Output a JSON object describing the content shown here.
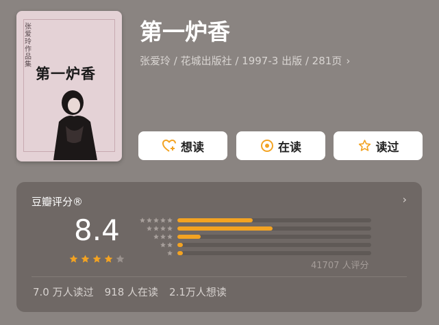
{
  "book": {
    "title": "第一炉香",
    "meta": "张爱玲 / 花城出版社 / 1997-3 出版 / 281页",
    "cover": {
      "author_series": "张爱玲作品集",
      "title": "第一炉香"
    }
  },
  "actions": [
    {
      "label": "想读",
      "icon": "heart-plus-icon"
    },
    {
      "label": "在读",
      "icon": "target-circle-icon"
    },
    {
      "label": "读过",
      "icon": "star-outline-icon"
    }
  ],
  "rating": {
    "label": "豆瓣评分®",
    "score": "8.4",
    "stars": 4,
    "distribution": [
      {
        "stars": 5,
        "fraction": 0.39
      },
      {
        "stars": 4,
        "fraction": 0.49
      },
      {
        "stars": 3,
        "fraction": 0.12
      },
      {
        "stars": 2,
        "fraction": 0.03
      },
      {
        "stars": 1,
        "fraction": 0.02
      }
    ],
    "raters": "41707 人评分"
  },
  "stats": {
    "read": "7.0 万人读过",
    "reading": "918 人在读",
    "want": "2.1万人想读"
  },
  "colors": {
    "background": "#8a8481",
    "card": "#6f6865",
    "accent": "#f3a322"
  }
}
